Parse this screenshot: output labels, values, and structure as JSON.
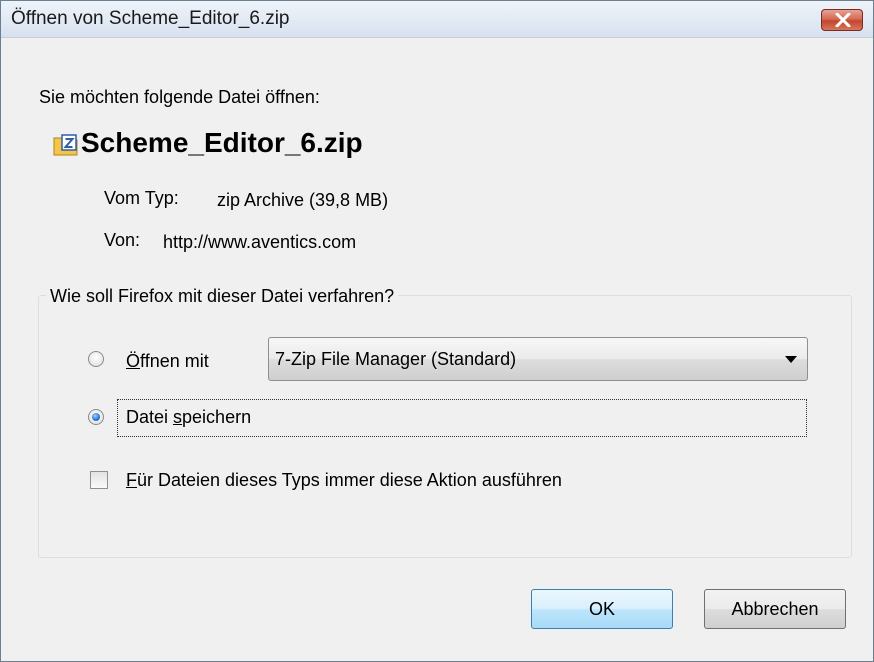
{
  "window": {
    "title_prefix": "Öffnen von ",
    "title_file": "Scheme_Editor_6.zip"
  },
  "prompt": "Sie möchten folgende Datei öffnen:",
  "file": {
    "name": "Scheme_Editor_6.zip",
    "icon": "zip-archive-icon",
    "type_label": "Vom Typ:",
    "type_value": "zip Archive (39,8 MB)",
    "from_label": "Von:",
    "from_value": "http://www.aventics.com"
  },
  "action_group": {
    "title": "Wie soll Firefox mit dieser Datei verfahren?",
    "open_with": {
      "mnemonic": "Ö",
      "label_rest": "ffnen mit",
      "selected": false,
      "app_selected": "7-Zip File Manager (Standard)"
    },
    "save_file": {
      "label_before": "Datei ",
      "mnemonic": "s",
      "label_after": "peichern",
      "selected": true
    },
    "remember": {
      "mnemonic": "F",
      "label_rest": "ür Dateien dieses Typs immer diese Aktion ausführen",
      "checked": false
    }
  },
  "buttons": {
    "ok": "OK",
    "cancel": "Abbrechen"
  },
  "colors": {
    "window_bg": "#f0f0f0",
    "close_button": "#c2462f",
    "default_button_border": "#3c7fb1"
  }
}
